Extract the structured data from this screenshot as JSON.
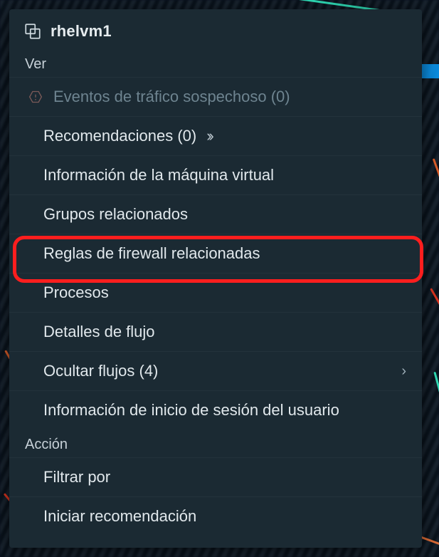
{
  "header": {
    "title": "rhelvm1"
  },
  "sections": {
    "ver": {
      "label": "Ver",
      "items": {
        "suspicious": "Eventos de tráfico sospechoso (0)",
        "recommendations": "Recomendaciones (0)",
        "vm_info": "Información de la máquina virtual",
        "related_groups": "Grupos relacionados",
        "firewall_rules": "Reglas de firewall relacionadas",
        "processes": "Procesos",
        "flow_details": "Detalles de flujo",
        "hide_flows": "Ocultar flujos (4)",
        "login_info": "Información de inicio de sesión del usuario"
      }
    },
    "accion": {
      "label": "Acción",
      "items": {
        "filter_by": "Filtrar por",
        "start_recommendation": "Iniciar recomendación"
      }
    }
  },
  "highlight": "firewall_rules",
  "colors": {
    "panel": "#1b2a33",
    "highlight": "#ff1e1e",
    "muted": "#6e8490"
  }
}
